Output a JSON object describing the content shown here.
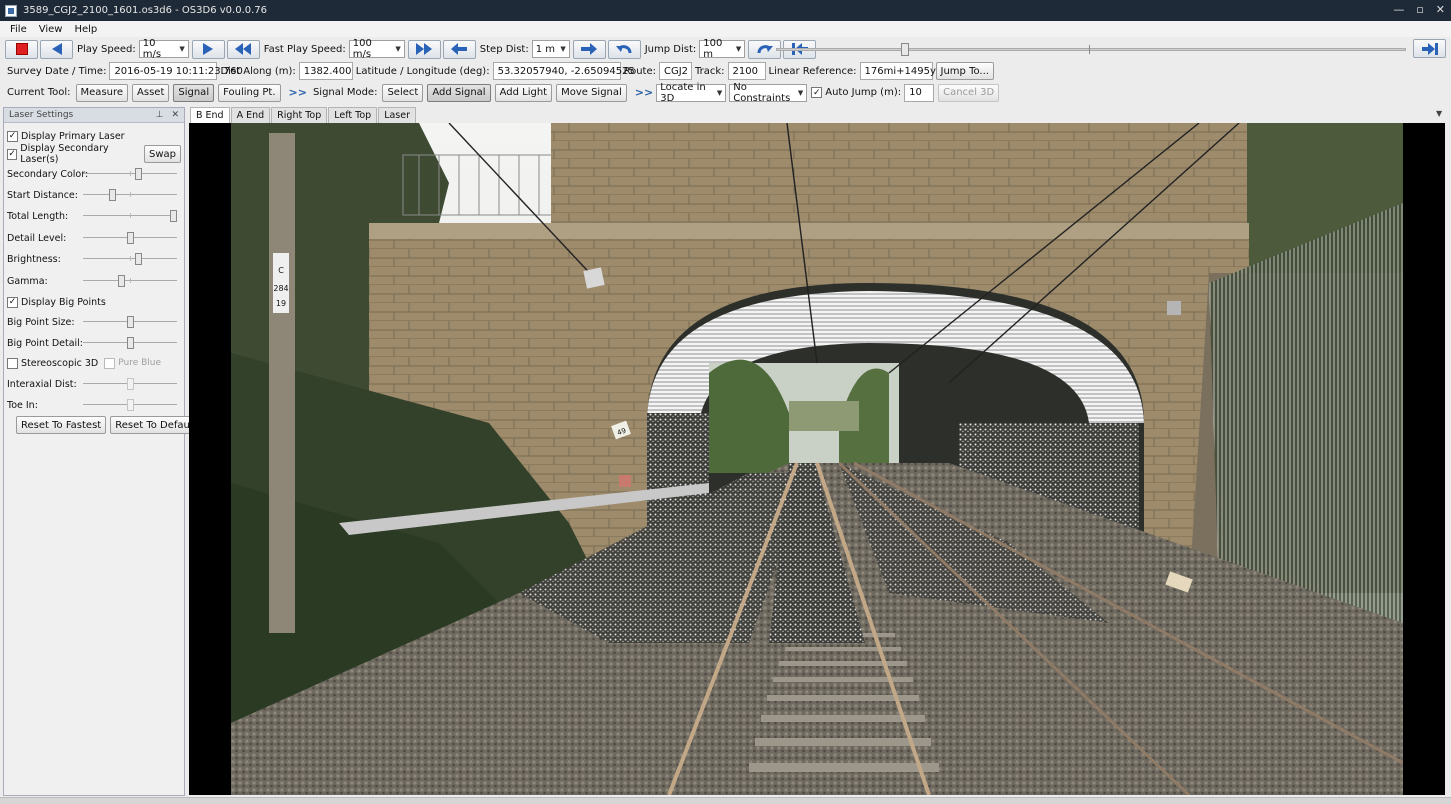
{
  "window": {
    "title": "3589_CGJ2_2100_1601.os3d6 - OS3D6 v0.0.0.76",
    "controls": [
      "—",
      "▫",
      "✕"
    ]
  },
  "menu": [
    "File",
    "View",
    "Help"
  ],
  "toolbar": {
    "play_speed_label": "Play Speed:",
    "play_speed": "10 m/s",
    "fast_play_speed_label": "Fast Play Speed:",
    "fast_play_speed": "100 m/s",
    "step_dist_label": "Step Dist:",
    "step_dist": "1 m",
    "jump_dist_label": "Jump Dist:",
    "jump_dist": "100 m",
    "slider_position": 0.2
  },
  "info": {
    "survey_label": "Survey Date / Time:",
    "survey_value": "2016-05-19 10:11:23.760",
    "dist_label": "Dist Along (m):",
    "dist_value": "1382.400",
    "latlon_label": "Latitude / Longitude (deg):",
    "latlon_value": "53.32057940, -2.65094525",
    "route_label": "Route:",
    "route_value": "CGJ2",
    "track_label": "Track:",
    "track_value": "2100",
    "linref_label": "Linear Reference:",
    "linref_value": "176mi+1495yd",
    "jump_button": "Jump To..."
  },
  "tools": {
    "current_label": "Current Tool:",
    "buttons": [
      "Measure",
      "Asset",
      "Signal",
      "Fouling Pt."
    ],
    "active_tool": "Signal",
    "signal_mode_label": "Signal Mode:",
    "signal_buttons": [
      "Select",
      "Add Signal",
      "Add Light",
      "Move Signal"
    ],
    "active_signal": "Add Signal",
    "locate": "Locate in 3D",
    "constraints": "No Constraints",
    "auto_jump_label": "Auto Jump (m):",
    "auto_jump_checked": true,
    "auto_jump_value": "10",
    "cancel_3d": "Cancel 3D"
  },
  "laser": {
    "title": "Laser Settings",
    "pin_icon": "pin-icon",
    "close_icon": "close-icon",
    "display_primary": "Display Primary Laser",
    "display_secondary": "Display Secondary Laser(s)",
    "swap": "Swap",
    "sliders": [
      {
        "label": "Secondary Color:",
        "value": 0.6
      },
      {
        "label": "Start Distance:",
        "value": 0.3
      },
      {
        "label": "Total Length:",
        "value": 1.0
      },
      {
        "label": "Detail Level:",
        "value": 0.5
      },
      {
        "label": "Brightness:",
        "value": 0.6
      },
      {
        "label": "Gamma:",
        "value": 0.4
      }
    ],
    "display_big_points": "Display Big Points",
    "big_sliders": [
      {
        "label": "Big Point Size:",
        "value": 0.5
      },
      {
        "label": "Big Point Detail:",
        "value": 0.5
      }
    ],
    "stereo": "Stereoscopic 3D",
    "pure_blue": "Pure Blue",
    "stereo_sliders": [
      {
        "label": "Interaxial Dist:",
        "value": 0.5
      },
      {
        "label": "Toe In:",
        "value": 0.5
      }
    ],
    "reset_fastest": "Reset To Fastest",
    "reset_default": "Reset To Default"
  },
  "view_tabs": [
    "B End",
    "A End",
    "Right Top",
    "Left Top",
    "Laser"
  ],
  "active_view_tab": "B End",
  "scene": {
    "sign_c": "C",
    "sign_284": "284",
    "sign_19": "19",
    "sign_49": "49"
  }
}
